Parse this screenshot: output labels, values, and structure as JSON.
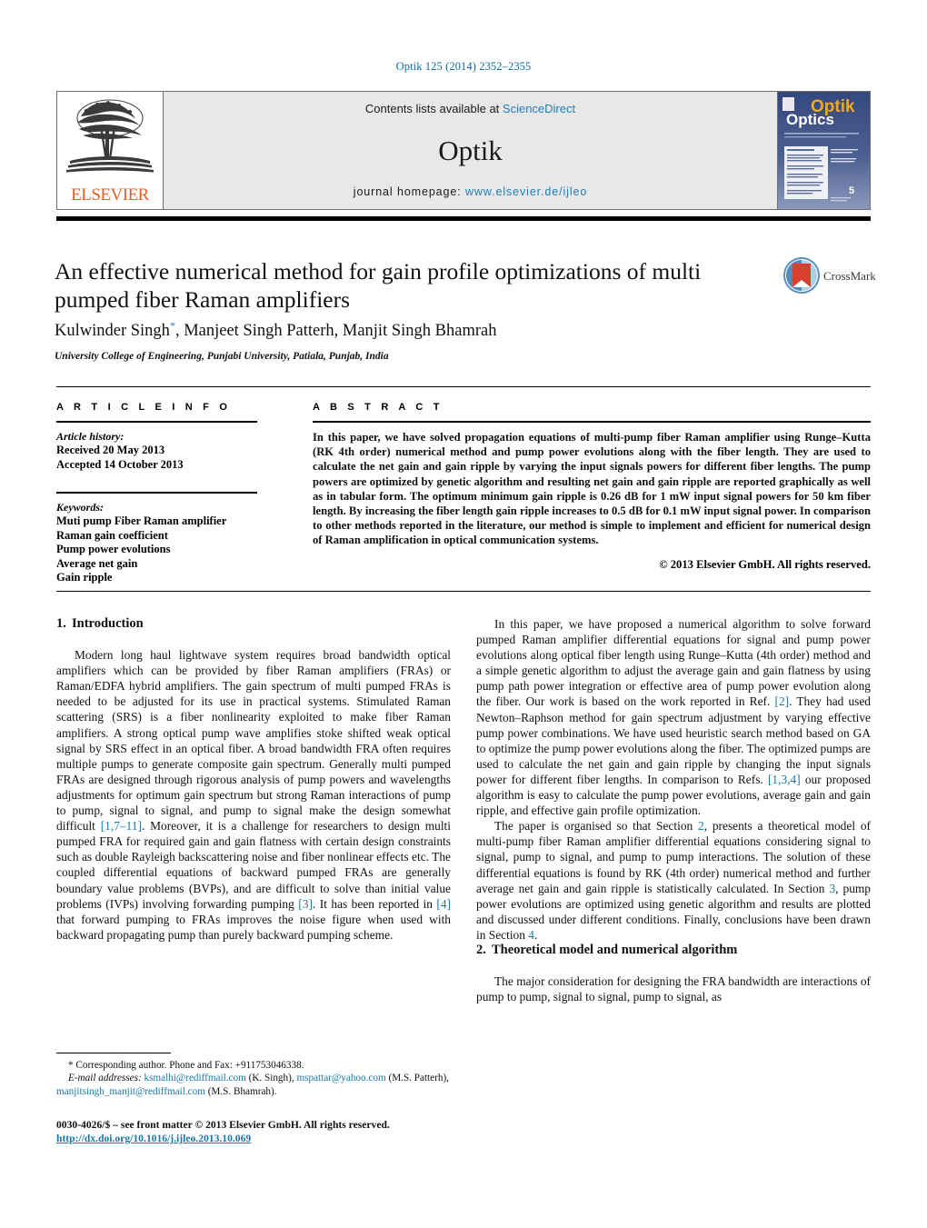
{
  "running_head": "Optik 125 (2014) 2352–2355",
  "masthead": {
    "publisher": "ELSEVIER",
    "contents_prefix": "Contents lists available at ",
    "contents_link": "ScienceDirect",
    "journal_name": "Optik",
    "homepage_label": "journal homepage:",
    "homepage_url": "www.elsevier.de/ijleo",
    "cover": {
      "title_top": "Optik",
      "title_bottom": "Optics"
    }
  },
  "article": {
    "title": "An effective numerical method for gain profile optimizations of multi pumped fiber Raman amplifiers",
    "authors": "Kulwinder Singh, Manjeet Singh Patterh, Manjit Singh Bhamrah",
    "author_star": "*",
    "affiliation": "University College of Engineering, Punjabi University, Patiala, Punjab, India",
    "crossmark_label": "CrossMark"
  },
  "article_info": {
    "heading": "A R T I C L E    I N F O",
    "history_label": "Article history:",
    "received": "Received 20 May 2013",
    "accepted": "Accepted 14 October 2013",
    "keywords_label": "Keywords:",
    "keywords": [
      "Muti pump Fiber Raman amplifier",
      "Raman gain coefficient",
      "Pump power evolutions",
      "Average net gain",
      "Gain ripple"
    ]
  },
  "abstract": {
    "heading": "A B S T R A C T",
    "body": "In this paper, we have solved propagation equations of multi-pump fiber Raman amplifier using Runge–Kutta (RK 4th order) numerical method and pump power evolutions along with the fiber length. They are used to calculate the net gain and gain ripple by varying the input signals powers for different fiber lengths. The pump powers are optimized by genetic algorithm and resulting net gain and gain ripple are reported graphically as well as in tabular form. The optimum minimum gain ripple is 0.26 dB for 1 mW input signal powers for 50 km fiber length. By increasing the fiber length gain ripple increases to 0.5 dB for 0.1 mW input signal power. In comparison to other methods reported in the literature, our method is simple to implement and efficient for numerical design of Raman amplification in optical communication systems.",
    "copyright": "© 2013 Elsevier GmbH. All rights reserved."
  },
  "sections": {
    "intro": {
      "number": "1.",
      "title": "Introduction",
      "paragraphs": [
        "Modern long haul lightwave system requires broad bandwidth optical amplifiers which can be provided by fiber Raman amplifiers (FRAs) or Raman/EDFA hybrid amplifiers. The gain spectrum of multi pumped FRAs is needed to be adjusted for its use in practical systems. Stimulated Raman scattering (SRS) is a fiber nonlinearity exploited to make fiber Raman amplifiers. A strong optical pump wave amplifies stoke shifted weak optical signal by SRS effect in an optical fiber. A broad bandwidth FRA often requires multiple pumps to generate composite gain spectrum. Generally multi pumped FRAs are designed through rigorous analysis of pump powers and wavelengths adjustments for optimum gain spectrum but strong Raman interactions of pump to pump, signal to signal, and pump to signal make the design somewhat difficult [1,7–11]. Moreover, it is a challenge for researchers to design multi pumped FRA for required gain and gain flatness with certain design constraints such as double Rayleigh backscattering noise and fiber nonlinear effects etc. The coupled differential equations of backward pumped FRAs are generally boundary value problems (BVPs), and are difficult to solve than initial value problems (IVPs) involving forwarding pumping [3]. It has been reported in [4] that forward pumping to FRAs improves the noise figure when used with backward propagating pump than purely backward pumping scheme."
      ]
    },
    "right_column": {
      "paragraph1": "In this paper, we have proposed a numerical algorithm to solve forward pumped Raman amplifier differential equations for signal and pump power evolutions along optical fiber length using Runge–Kutta (4th order) method and a simple genetic algorithm to adjust the average gain and gain flatness by using pump path power integration or effective area of pump power evolution along the fiber. Our work is based on the work reported in Ref. [2]. They had used Newton–Raphson method for gain spectrum adjustment by varying effective pump power combinations. We have used heuristic search method based on GA to optimize the pump power evolutions along the fiber. The optimized pumps are used to calculate the net gain and gain ripple by changing the input signals power for different fiber lengths. In comparison to Refs. [1,3,4] our proposed algorithm is easy to calculate the pump power evolutions, average gain and gain ripple, and effective gain profile optimization.",
      "paragraph2": "The paper is organised so that Section 2, presents a theoretical model of multi-pump fiber Raman amplifier differential equations considering signal to signal, pump to signal, and pump to pump interactions. The solution of these differential equations is found by RK (4th order) numerical method and further average net gain and gain ripple is statistically calculated. In Section 3, pump power evolutions are optimized using genetic algorithm and results are plotted and discussed under different conditions. Finally, conclusions have been drawn in Section 4."
    },
    "theoretical": {
      "number": "2.",
      "title": "Theoretical model and numerical algorithm",
      "paragraph": "The major consideration for designing the FRA bandwidth are interactions of pump to pump, signal to signal, pump to signal, as"
    }
  },
  "footnotes": {
    "corresponding": "* Corresponding author. Phone and Fax: +911753046338.",
    "email_label": "E-mail addresses:",
    "emails": [
      {
        "address": "ksmalhi@rediffmail.com",
        "person": "(K. Singh)"
      },
      {
        "address": "mspattar@yahoo.com",
        "person": "(M.S. Patterh)"
      },
      {
        "address": "manjitsingh_manjit@rediffmail.com",
        "person": "(M.S. Bhamrah)."
      }
    ]
  },
  "bottom": {
    "issn_line": "0030-4026/$ – see front matter © 2013 Elsevier GmbH. All rights reserved.",
    "doi": "http://dx.doi.org/10.1016/j.ijleo.2013.10.069"
  },
  "colors": {
    "link": "#1878a8",
    "elsevier_orange": "#ea5c24",
    "header_blue": "#0b6a9e",
    "cover_blue": "#2b3f74"
  }
}
